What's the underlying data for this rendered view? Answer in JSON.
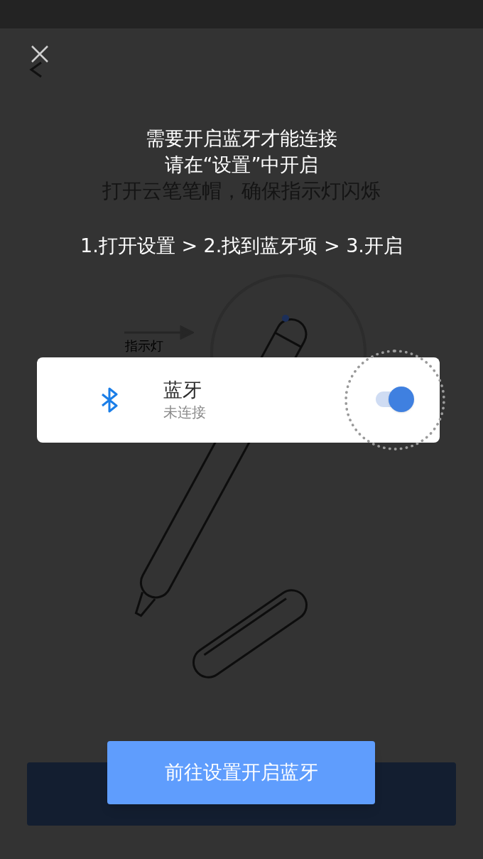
{
  "background_screen": {
    "title": "打开云笔笔帽，确保指示灯闪烁",
    "indicator_label": "指示灯"
  },
  "dialog": {
    "message_lines": [
      "需要开启蓝牙才能连接",
      "请在“设置”中开启"
    ],
    "steps": "1.打开设置 > 2.找到蓝牙项 > 3.开启",
    "setting": {
      "label": "蓝牙",
      "status": "未连接",
      "on": true
    },
    "button": "前往设置开启蓝牙"
  }
}
